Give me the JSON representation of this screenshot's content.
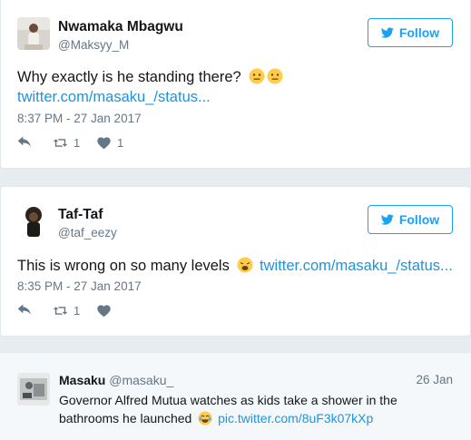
{
  "tweets": [
    {
      "name": "Nwamaka Mbagwu",
      "handle": "@Maksyy_M",
      "follow_label": "Follow",
      "text": "Why exactly is he standing there?",
      "link": "twitter.com/masaku_/status...",
      "timestamp": "8:37 PM - 27 Jan 2017",
      "retweets": "1",
      "likes": "1"
    },
    {
      "name": "Taf-Taf",
      "handle": "@taf_eezy",
      "follow_label": "Follow",
      "text": "This is wrong on so many levels",
      "link": "twitter.com/masaku_/status...",
      "timestamp": "8:35 PM - 27 Jan 2017",
      "retweets": "1",
      "likes": ""
    }
  ],
  "quoted_tweet": {
    "name": "Masaku",
    "handle": "@masaku_",
    "date": "26 Jan",
    "text": "Governor Alfred Mutua watches as kids take a shower in the bathrooms he launched",
    "link": "pic.twitter.com/8uF3k07kXp"
  },
  "colors": {
    "accent": "#1da1f2",
    "link": "#1b95e0",
    "muted": "#657786",
    "background": "#e6ecf0"
  },
  "icons": [
    "twitter-bird-icon",
    "reply-icon",
    "retweet-icon",
    "heart-icon",
    "neutral-face-emoji",
    "weary-face-emoji",
    "tears-of-joy-emoji"
  ]
}
